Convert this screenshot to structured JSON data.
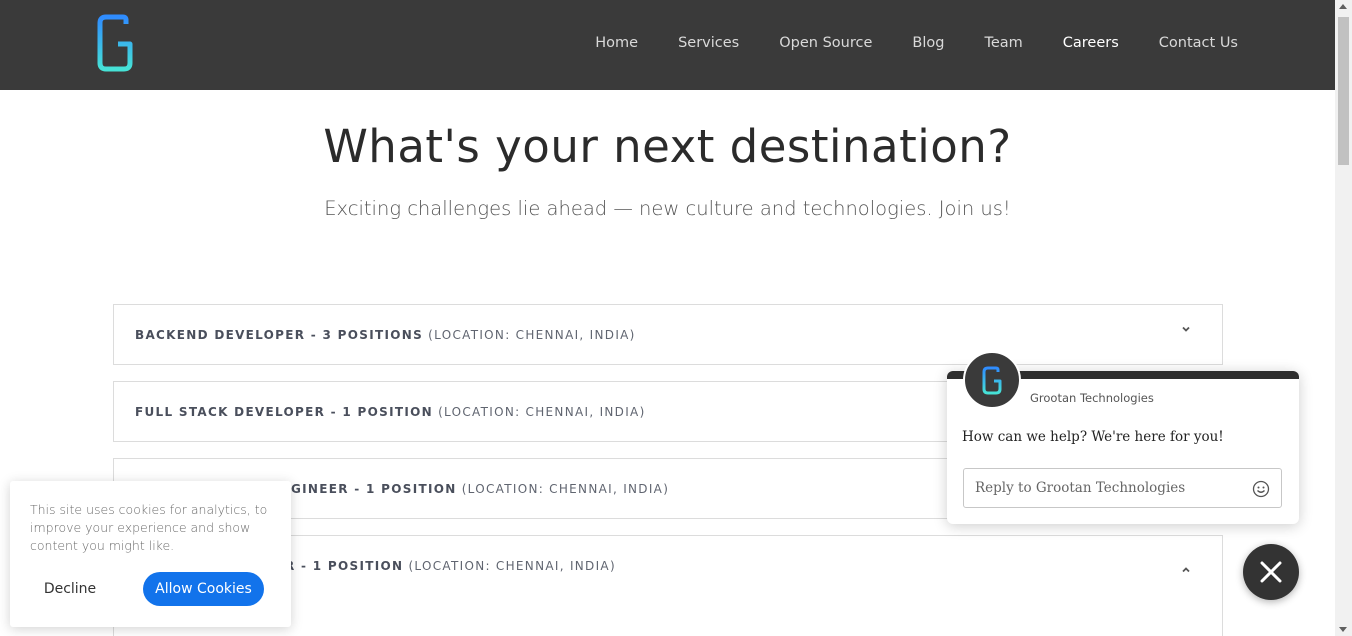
{
  "nav": {
    "items": [
      {
        "label": "Home"
      },
      {
        "label": "Services"
      },
      {
        "label": "Open Source"
      },
      {
        "label": "Blog"
      },
      {
        "label": "Team"
      },
      {
        "label": "Careers",
        "active": true
      },
      {
        "label": "Contact Us"
      }
    ]
  },
  "hero": {
    "title": "What's your next destination?",
    "subtitle": "Exciting challenges lie ahead — new culture and technologies. Join us!"
  },
  "jobs": [
    {
      "title": "BACKEND DEVELOPER - 3 POSITIONS",
      "location": "(LOCATION: CHENNAI, INDIA)",
      "icon": "chevron-down-icon"
    },
    {
      "title": "FULL STACK DEVELOPER - 1 POSITION",
      "location": "(LOCATION: CHENNAI, INDIA)"
    },
    {
      "title": "GINEER - 1 POSITION",
      "location": "(LOCATION: CHENNAI, INDIA)"
    },
    {
      "title": "R - 1 POSITION",
      "location": "(LOCATION: CHENNAI, INDIA)",
      "icon": "chevron-up-icon"
    }
  ],
  "cookie": {
    "text": "This site uses cookies for analytics, to improve your experience and show content you might like.",
    "decline": "Decline",
    "allow": "Allow Cookies"
  },
  "chat": {
    "name": "Grootan Technologies",
    "message": "How can we help? We're here for you!",
    "placeholder": "Reply to Grootan Technologies"
  },
  "colors": {
    "header_bg": "#3a3a3a",
    "accent_blue": "#1273eb",
    "logo_gradient_start": "#1e90ff",
    "logo_gradient_end": "#4ee6d0"
  }
}
